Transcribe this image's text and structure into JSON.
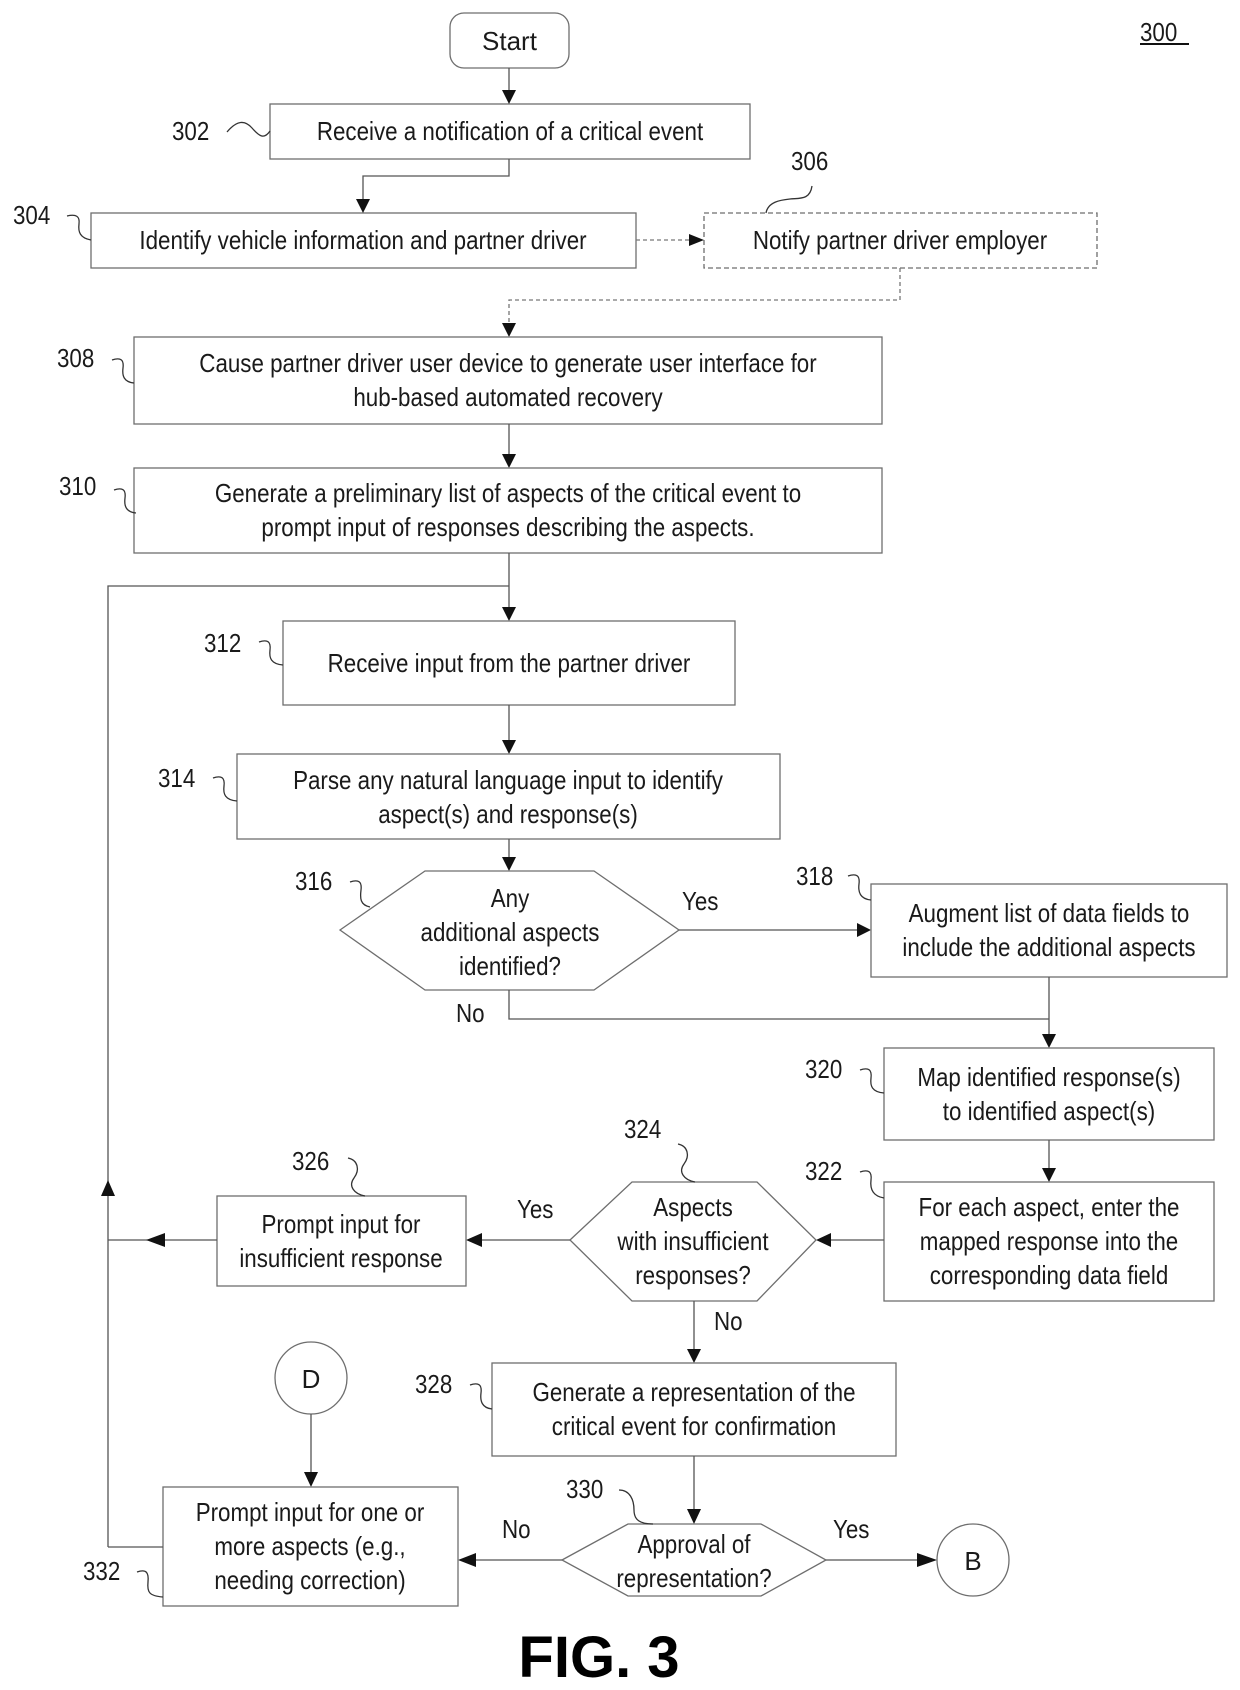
{
  "figure": {
    "number": "300",
    "caption": "FIG. 3"
  },
  "nodes": {
    "start": {
      "label": "Start"
    },
    "n302": {
      "ref": "302",
      "lines": [
        "Receive a notification of a critical event"
      ]
    },
    "n304": {
      "ref": "304",
      "lines": [
        "Identify vehicle information and partner driver"
      ]
    },
    "n306": {
      "ref": "306",
      "lines": [
        "Notify partner driver employer"
      ],
      "optional": true
    },
    "n308": {
      "ref": "308",
      "lines": [
        "Cause partner driver user device to generate user interface for",
        "hub-based automated recovery"
      ]
    },
    "n310": {
      "ref": "310",
      "lines": [
        "Generate a preliminary list of aspects of the critical event to",
        "prompt input of responses describing the aspects."
      ]
    },
    "n312": {
      "ref": "312",
      "lines": [
        "Receive input from the partner driver"
      ]
    },
    "n314": {
      "ref": "314",
      "lines": [
        "Parse any natural language input to identify",
        "aspect(s) and response(s)"
      ]
    },
    "n316": {
      "ref": "316",
      "lines": [
        "Any",
        "additional aspects",
        "identified?"
      ]
    },
    "n318": {
      "ref": "318",
      "lines": [
        "Augment list of data fields to",
        "include the additional aspects"
      ]
    },
    "n320": {
      "ref": "320",
      "lines": [
        "Map identified response(s)",
        "to identified aspect(s)"
      ]
    },
    "n322": {
      "ref": "322",
      "lines": [
        "For each aspect, enter the",
        "mapped response into the",
        "corresponding data field"
      ]
    },
    "n324": {
      "ref": "324",
      "lines": [
        "Aspects",
        "with insufficient",
        "responses?"
      ]
    },
    "n326": {
      "ref": "326",
      "lines": [
        "Prompt input for",
        "insufficient response"
      ]
    },
    "n328": {
      "ref": "328",
      "lines": [
        "Generate a representation of the",
        "critical event for confirmation"
      ]
    },
    "n330": {
      "ref": "330",
      "lines": [
        "Approval of",
        "representation?"
      ]
    },
    "n332": {
      "ref": "332",
      "lines": [
        "Prompt input for one or",
        "more aspects (e.g.,",
        "needing correction)"
      ]
    },
    "connD": {
      "label": "D"
    },
    "connB": {
      "label": "B"
    }
  },
  "edge_labels": {
    "e316_yes": "Yes",
    "e316_no": "No",
    "e324_yes": "Yes",
    "e324_no": "No",
    "e330_no": "No",
    "e330_yes": "Yes"
  }
}
